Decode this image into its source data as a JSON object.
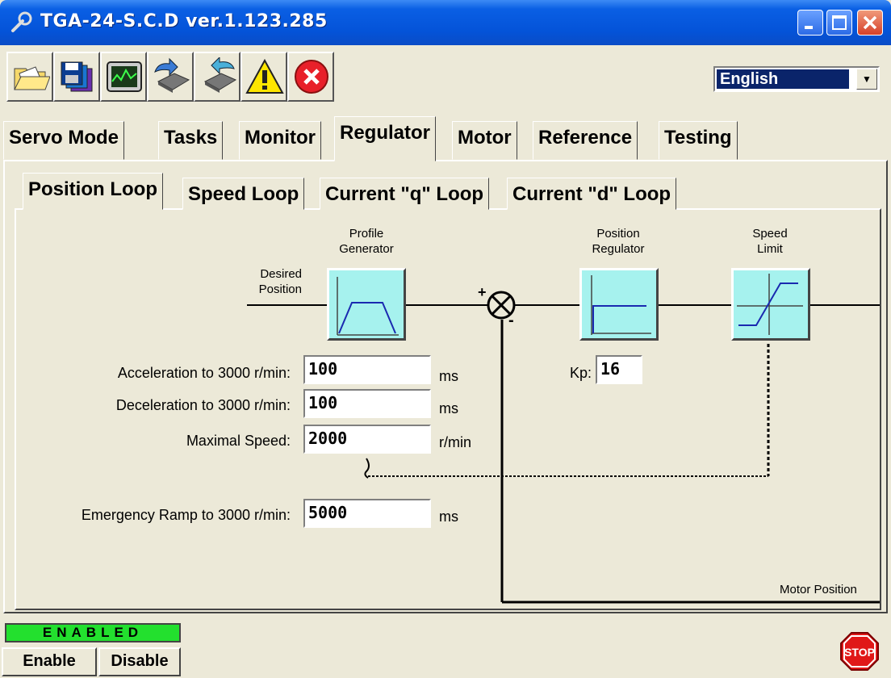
{
  "window": {
    "title": "TGA-24-S.C.D  ver.1.123.285"
  },
  "toolbar": {
    "icons": [
      "open-folder-icon",
      "save-disk-icon",
      "monitor-scope-icon",
      "upload-chip-icon",
      "download-chip-icon",
      "warning-icon",
      "error-stop-icon"
    ],
    "language": "English"
  },
  "tabs": [
    "Servo Mode",
    "Tasks",
    "Monitor",
    "Regulator",
    "Motor",
    "Reference",
    "Testing"
  ],
  "selected_tab": "Regulator",
  "subtabs": [
    "Position Loop",
    "Speed Loop",
    "Current \"q\" Loop",
    "Current \"d\" Loop"
  ],
  "selected_subtab": "Position Loop",
  "diagram": {
    "desired_position": "Desired\nPosition",
    "profile_generator": "Profile\nGenerator",
    "position_regulator": "Position\nRegulator",
    "speed_limit": "Speed\nLimit",
    "sum_plus": "+",
    "sum_minus": "-",
    "kp_label": "Kp:",
    "kp_value": "16",
    "motor_position": "Motor Position"
  },
  "params": {
    "accel_label": "Acceleration to 3000 r/min:",
    "accel_value": "100",
    "accel_unit": "ms",
    "decel_label": "Deceleration to 3000 r/min:",
    "decel_value": "100",
    "decel_unit": "ms",
    "maxspeed_label": "Maximal Speed:",
    "maxspeed_value": "2000",
    "maxspeed_unit": "r/min",
    "emergency_label": "Emergency Ramp to 3000 r/min:",
    "emergency_value": "5000",
    "emergency_unit": "ms"
  },
  "status": {
    "text": "ENABLED",
    "color": "#23e02e"
  },
  "buttons": {
    "enable": "Enable",
    "disable": "Disable",
    "stop": "STOP"
  }
}
